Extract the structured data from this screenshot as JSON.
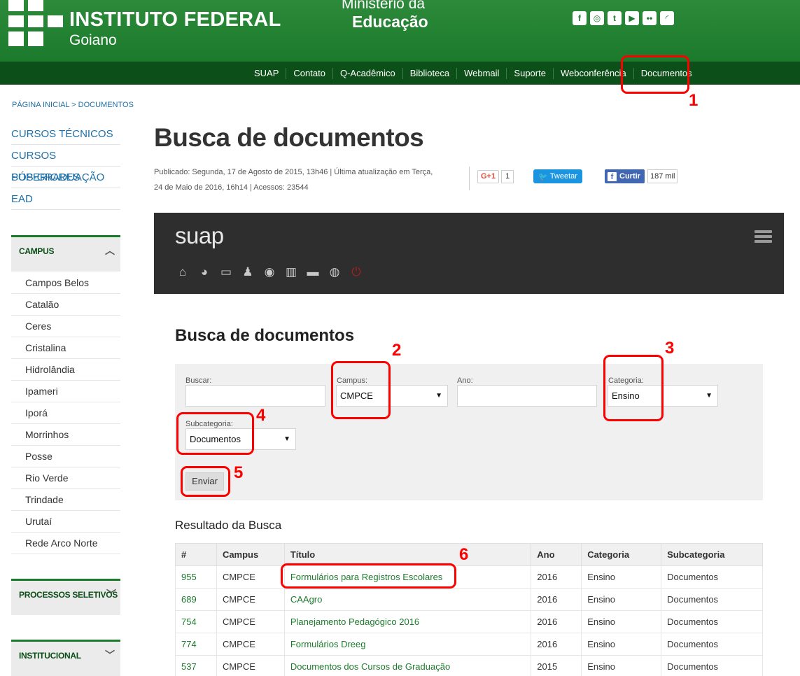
{
  "header": {
    "brand_title": "INSTITUTO FEDERAL",
    "brand_subtitle": "Goiano",
    "ministry_line1": "Ministério da",
    "ministry_line2": "Educação",
    "social_icons": [
      "facebook-icon",
      "instagram-icon",
      "twitter-icon",
      "youtube-icon",
      "flickr-icon",
      "rss-icon"
    ]
  },
  "topnav": {
    "items": [
      "SUAP",
      "Contato",
      "Q-Acadêmico",
      "Biblioteca",
      "Webmail",
      "Suporte",
      "Webconferência",
      "Documentos"
    ]
  },
  "annotations": [
    "1",
    "2",
    "3",
    "4",
    "5",
    "6"
  ],
  "sidebar": {
    "breadcrumb": "PÁGINA INICIAL > DOCUMENTOS",
    "main_links": [
      "CURSOS TÉCNICOS",
      "CURSOS SUPERIORES",
      "PÓS-GRADUAÇÃO",
      "EAD"
    ],
    "campus_header": "CAMPUS",
    "campus_items": [
      "Campos Belos",
      "Catalão",
      "Ceres",
      "Cristalina",
      "Hidrolândia",
      "Ipameri",
      "Iporá",
      "Morrinhos",
      "Posse",
      "Rio Verde",
      "Trindade",
      "Urutaí",
      "Rede Arco Norte"
    ],
    "processos_header": "PROCESSOS SELETIVOS",
    "institucional_header": "INSTITUCIONAL"
  },
  "content": {
    "title": "Busca de documentos",
    "meta_line1": "Publicado: Segunda, 17 de Agosto de 2015, 13h46 | Última atualização em Terça,",
    "meta_line2": "24 de Maio de 2016, 16h14 | Acessos: 23544",
    "gplus_label": "G+1",
    "gplus_count": "1",
    "tweet_label": "Tweetar",
    "fb_label": "Curtir",
    "fb_count": "187 mil"
  },
  "suap": {
    "logo": "suap",
    "icons": [
      "home-icon",
      "pie-chart-icon",
      "monitor-icon",
      "user-icon",
      "compass-icon",
      "bar-chart-icon",
      "briefcase-icon",
      "globe-icon",
      "power-icon"
    ]
  },
  "form": {
    "title": "Busca de documentos",
    "buscar_label": "Buscar:",
    "buscar_value": "",
    "campus_label": "Campus:",
    "campus_value": "CMPCE",
    "ano_label": "Ano:",
    "ano_value": "",
    "categoria_label": "Categoria:",
    "categoria_value": "Ensino",
    "subcategoria_label": "Subcategoria:",
    "subcategoria_value": "Documentos",
    "submit_label": "Enviar"
  },
  "results": {
    "title": "Resultado da Busca",
    "columns": [
      "#",
      "Campus",
      "Título",
      "Ano",
      "Categoria",
      "Subcategoria"
    ],
    "rows": [
      [
        "955",
        "CMPCE",
        "Formulários para Registros Escolares",
        "2016",
        "Ensino",
        "Documentos"
      ],
      [
        "689",
        "CMPCE",
        "CAAgro",
        "2016",
        "Ensino",
        "Documentos"
      ],
      [
        "754",
        "CMPCE",
        "Planejamento Pedagógico 2016",
        "2016",
        "Ensino",
        "Documentos"
      ],
      [
        "774",
        "CMPCE",
        "Formulários Dreeg",
        "2016",
        "Ensino",
        "Documentos"
      ],
      [
        "537",
        "CMPCE",
        "Documentos dos Cursos de Graduação",
        "2015",
        "Ensino",
        "Documentos"
      ]
    ]
  },
  "colors": {
    "header_green": "#1b7a2c",
    "nav_green": "#0c4f18",
    "annotation_red": "#ff0000",
    "link_green": "#1e7b2e",
    "link_blue": "#1e6fa8"
  }
}
